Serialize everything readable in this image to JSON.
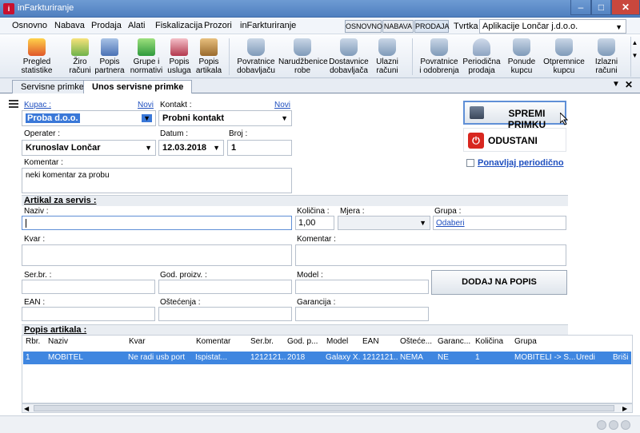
{
  "window": {
    "title": "inFarkturiranje"
  },
  "menu": {
    "items": [
      "Osnovno",
      "Nabava",
      "Prodaja",
      "Alati",
      "Fiskalizacija",
      "Prozori",
      "inFarkturiranje"
    ],
    "modes": [
      "OSNOVNO",
      "NABAVA",
      "PRODAJA"
    ],
    "company_label": "Tvrtka :",
    "company_value": "Aplikacije Lončar j.d.o.o."
  },
  "ribbon": {
    "buttons": [
      [
        "Pregled",
        "statistike"
      ],
      [
        "Žiro",
        "računi"
      ],
      [
        "Popis",
        "partnera"
      ],
      [
        "Grupe i",
        "normativi"
      ],
      [
        "Popis",
        "usluga"
      ],
      [
        "Popis",
        "artikala"
      ],
      [
        "Povratnice",
        "dobavljaču"
      ],
      [
        "Narudžbenice",
        "robe"
      ],
      [
        "Dostavnice",
        "dobavljača"
      ],
      [
        "Ulazni",
        "računi"
      ],
      [
        "Povratnice",
        "i odobrenja"
      ],
      [
        "Periodična",
        "prodaja"
      ],
      [
        "Ponude",
        "kupcu"
      ],
      [
        "Otpremnice",
        "kupcu"
      ],
      [
        "Izlazni",
        "računi"
      ]
    ]
  },
  "tabs": [
    "Servisne primke",
    "Unos servisne primke"
  ],
  "form": {
    "kupac_label": "Kupac :",
    "kupac_value": "Proba d.o.o.",
    "novi": "Novi",
    "kontakt_label": "Kontakt :",
    "kontakt_value": "Probni kontakt",
    "operater_label": "Operater :",
    "operater_value": "Krunoslav Lončar",
    "datum_label": "Datum :",
    "datum_value": "12.03.2018",
    "broj_label": "Broj :",
    "broj_value": "1",
    "komentar_label": "Komentar :",
    "komentar_value": "neki komentar za probu"
  },
  "actions": {
    "save": "SPREMI PRIMKU",
    "cancel": "ODUSTANI",
    "repeat": "Ponavljaj periodično"
  },
  "artikal": {
    "section_title": "Artikal za servis :",
    "naziv_label": "Naziv :",
    "kolicina_label": "Količina :",
    "kolicina_value": "1,00",
    "mjera_label": "Mjera :",
    "grupa_label": "Grupa :",
    "grupa_link": "Odaberi",
    "kvar_label": "Kvar :",
    "komentar_label": "Komentar :",
    "serbr_label": "Ser.br. :",
    "godproizv_label": "God. proizv. :",
    "model_label": "Model :",
    "ean_label": "EAN :",
    "ostecenja_label": "Oštećenja :",
    "garancija_label": "Garancija :",
    "add_button": "DODAJ NA POPIS"
  },
  "popis": {
    "section_title": "Popis artikala :",
    "columns": [
      "Rbr.",
      "Naziv",
      "Kvar",
      "Komentar",
      "Ser.br.",
      "God. p...",
      "Model",
      "EAN",
      "Ošteće...",
      "Garanc...",
      "Količina",
      "Grupa"
    ],
    "rows": [
      [
        "1",
        "MOBITEL",
        "Ne radi usb port",
        "Ispistat...",
        "1212121...",
        "2018",
        "Galaxy X...",
        "1212121...",
        "NEMA",
        "NE",
        "1",
        "MOBITELI -> S...",
        "Uredi",
        "Briši"
      ]
    ]
  }
}
